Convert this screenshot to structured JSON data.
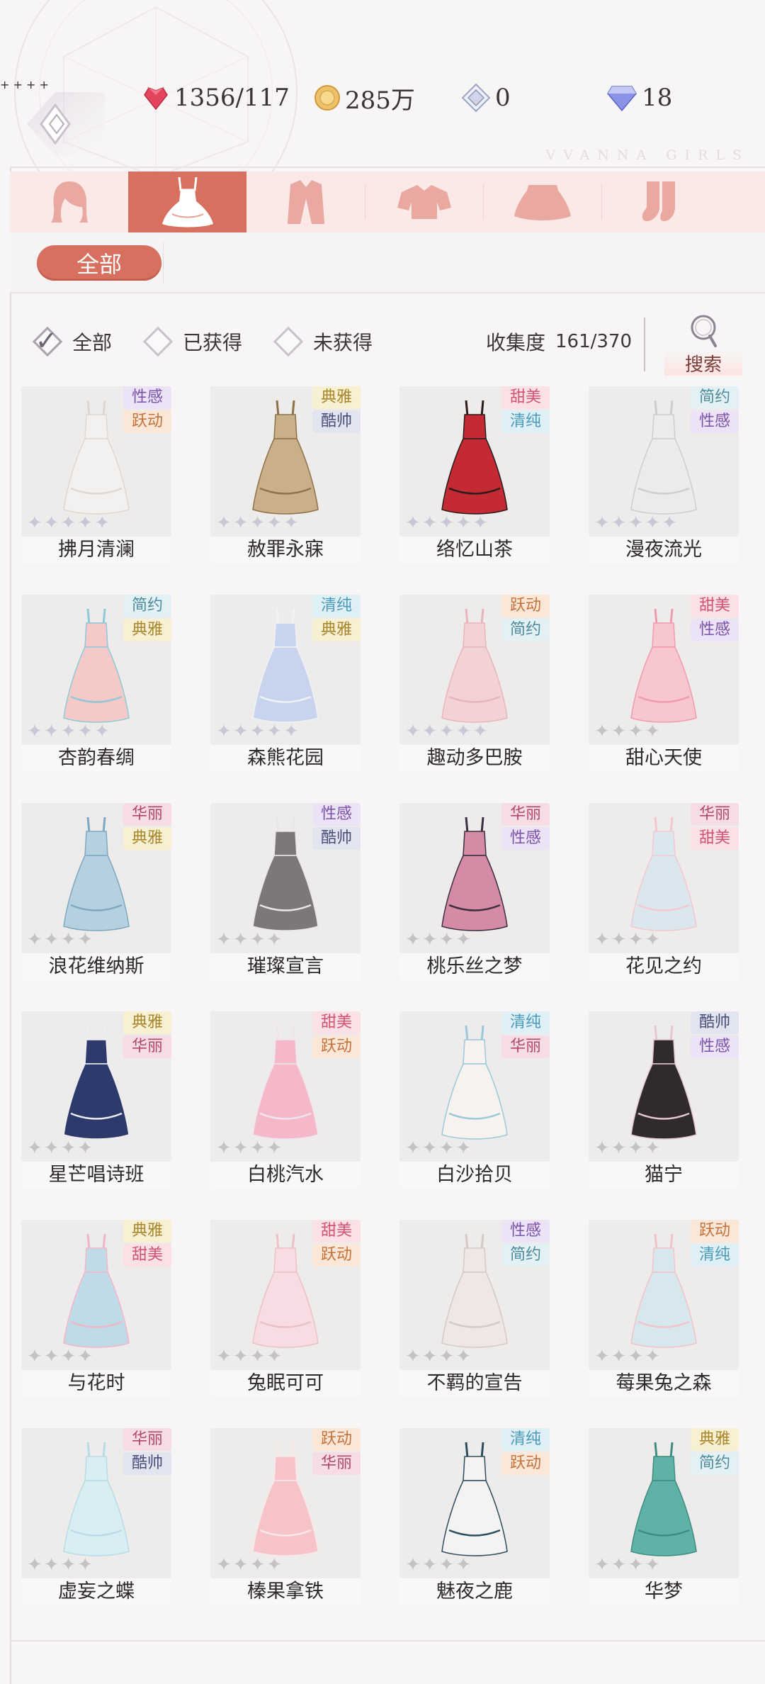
{
  "header": {
    "brand": "VVANNA GIRLS",
    "currencies": [
      {
        "name": "stamina",
        "icon": "heart-gem-icon",
        "value": "1356/117",
        "color": "#e0425c"
      },
      {
        "name": "gold",
        "icon": "gold-coin-icon",
        "value": "285万",
        "color": "#e6b552"
      },
      {
        "name": "crystal",
        "icon": "crystal-icon",
        "value": "0",
        "color": "#8fa0c8"
      },
      {
        "name": "diamond",
        "icon": "diamond-icon",
        "value": "18",
        "color": "#6a72d8"
      }
    ],
    "plus": "+"
  },
  "category_tabs": [
    {
      "icon": "hair-icon",
      "active": false
    },
    {
      "icon": "dress-icon",
      "active": true
    },
    {
      "icon": "coat-icon",
      "active": false
    },
    {
      "icon": "top-icon",
      "active": false
    },
    {
      "icon": "skirt-icon",
      "active": false
    },
    {
      "icon": "socks-icon",
      "active": false
    }
  ],
  "sub_filter": {
    "label": "全部"
  },
  "filters": {
    "all": "全部",
    "obtained": "已获得",
    "not_obtained": "未获得",
    "selected": "all"
  },
  "collection": {
    "label": "收集度",
    "value": "161/370"
  },
  "search": {
    "label": "搜索"
  },
  "tag_colors": {
    "性感": {
      "bg": "#ece3f6",
      "fg": "#7a52a8"
    },
    "跃动": {
      "bg": "#fbe7d8",
      "fg": "#c4723a"
    },
    "典雅": {
      "bg": "#f8f0d2",
      "fg": "#a8862c"
    },
    "酷帅": {
      "bg": "#e2e4ef",
      "fg": "#4a4f7a"
    },
    "甜美": {
      "bg": "#fbe1e6",
      "fg": "#d25272"
    },
    "清纯": {
      "bg": "#def0f6",
      "fg": "#4a9ab8"
    },
    "简约": {
      "bg": "#e3f0f4",
      "fg": "#4b8b9c"
    },
    "华丽": {
      "bg": "#f6dce4",
      "fg": "#b04a6a"
    }
  },
  "items": [
    {
      "name": "拂月清澜",
      "tags": [
        "性感",
        "跃动"
      ],
      "dress": "#f3f1f0",
      "accent": "#dcd8d6",
      "stars": 5,
      "obtained": true
    },
    {
      "name": "赦罪永寐",
      "tags": [
        "典雅",
        "酷帅"
      ],
      "dress": "#c9b089",
      "accent": "#8e7249",
      "stars": 5,
      "obtained": true
    },
    {
      "name": "络忆山茶",
      "tags": [
        "甜美",
        "清纯"
      ],
      "dress": "#c42a33",
      "accent": "#2a1c1c",
      "stars": 5,
      "obtained": true
    },
    {
      "name": "漫夜流光",
      "tags": [
        "简约",
        "性感"
      ],
      "dress": "#ecebeb",
      "accent": "#cfcccc",
      "stars": 5,
      "obtained": true
    },
    {
      "name": "杏韵春绸",
      "tags": [
        "简约",
        "典雅"
      ],
      "dress": "#f5c9c8",
      "accent": "#8fc9d6",
      "stars": 5,
      "obtained": true
    },
    {
      "name": "森熊花园",
      "tags": [
        "清纯",
        "典雅"
      ],
      "dress": "#c8d4ee",
      "accent": "#f2f2f6",
      "stars": 5,
      "obtained": true
    },
    {
      "name": "趣动多巴胺",
      "tags": [
        "跃动",
        "简约"
      ],
      "dress": "#f2d2d4",
      "accent": "#e8b6ba",
      "stars": 5,
      "obtained": true
    },
    {
      "name": "甜心天使",
      "tags": [
        "甜美",
        "性感"
      ],
      "dress": "#f7c6cf",
      "accent": "#ee9cad",
      "stars": 4,
      "obtained": false
    },
    {
      "name": "浪花维纳斯",
      "tags": [
        "华丽",
        "典雅"
      ],
      "dress": "#b5d0df",
      "accent": "#7fa8c2",
      "stars": 4,
      "obtained": false
    },
    {
      "name": "璀璨宣言",
      "tags": [
        "性感",
        "酷帅"
      ],
      "dress": "#7c7878",
      "accent": "#e8e6e6",
      "stars": 4,
      "obtained": false
    },
    {
      "name": "桃乐丝之梦",
      "tags": [
        "华丽",
        "性感"
      ],
      "dress": "#d58aa6",
      "accent": "#3b3040",
      "stars": 4,
      "obtained": false
    },
    {
      "name": "花见之约",
      "tags": [
        "华丽",
        "甜美"
      ],
      "dress": "#dbe7ee",
      "accent": "#f3c8cf",
      "stars": 4,
      "obtained": false
    },
    {
      "name": "星芒唱诗班",
      "tags": [
        "典雅",
        "华丽"
      ],
      "dress": "#2d3a6b",
      "accent": "#eeeef2",
      "stars": 4,
      "obtained": false
    },
    {
      "name": "白桃汽水",
      "tags": [
        "甜美",
        "跃动"
      ],
      "dress": "#f5b8c8",
      "accent": "#f0e4ee",
      "stars": 4,
      "obtained": false
    },
    {
      "name": "白沙拾贝",
      "tags": [
        "清纯",
        "华丽"
      ],
      "dress": "#f6f3ee",
      "accent": "#9cc8dc",
      "stars": 4,
      "obtained": false
    },
    {
      "name": "猫宁",
      "tags": [
        "酷帅",
        "性感"
      ],
      "dress": "#2f2b2b",
      "accent": "#e3c8cf",
      "stars": 4,
      "obtained": false
    },
    {
      "name": "与花时",
      "tags": [
        "典雅",
        "甜美"
      ],
      "dress": "#bfdbe8",
      "accent": "#f0b6c8",
      "stars": 4,
      "obtained": false
    },
    {
      "name": "兔眠可可",
      "tags": [
        "甜美",
        "跃动"
      ],
      "dress": "#f7dde3",
      "accent": "#ecc0cb",
      "stars": 4,
      "obtained": false
    },
    {
      "name": "不羁的宣告",
      "tags": [
        "性感",
        "简约"
      ],
      "dress": "#efe6e6",
      "accent": "#d6c8c8",
      "stars": 4,
      "obtained": false
    },
    {
      "name": "莓果兔之森",
      "tags": [
        "跃动",
        "清纯"
      ],
      "dress": "#d6e8ee",
      "accent": "#f2c2c9",
      "stars": 4,
      "obtained": false
    },
    {
      "name": "虚妄之蝶",
      "tags": [
        "华丽",
        "酷帅"
      ],
      "dress": "#d9eef3",
      "accent": "#b9dbe6",
      "stars": 4,
      "obtained": false
    },
    {
      "name": "榛果拿铁",
      "tags": [
        "跃动",
        "华丽"
      ],
      "dress": "#f6c3c9",
      "accent": "#f9e8ea",
      "stars": 4,
      "obtained": false
    },
    {
      "name": "魅夜之鹿",
      "tags": [
        "清纯",
        "跃动"
      ],
      "dress": "#f4f3f2",
      "accent": "#2b4e5e",
      "stars": 4,
      "obtained": false
    },
    {
      "name": "华梦",
      "tags": [
        "典雅",
        "简约"
      ],
      "dress": "#5fb3a6",
      "accent": "#3f8d82",
      "stars": 4,
      "obtained": false
    }
  ]
}
